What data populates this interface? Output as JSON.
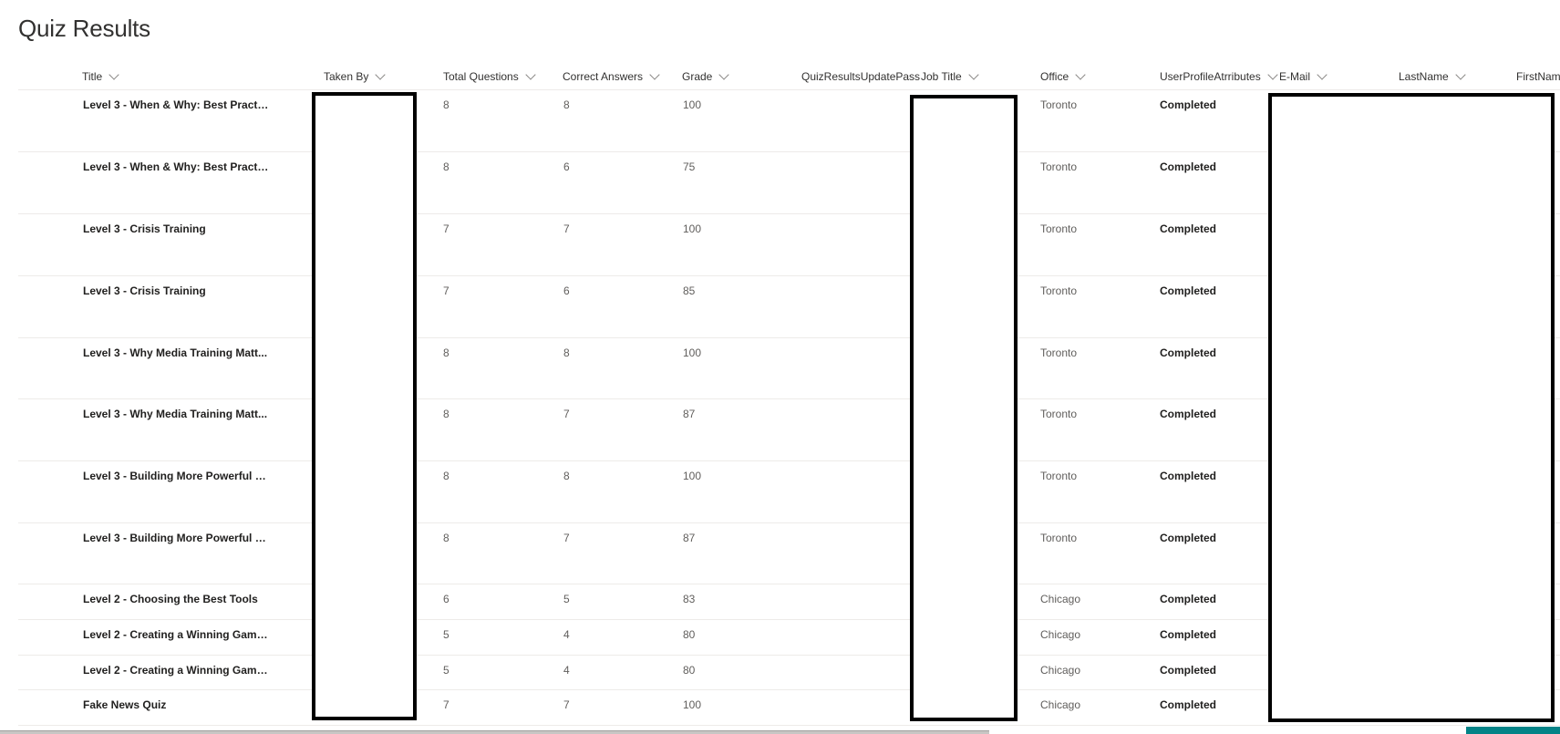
{
  "page": {
    "title": "Quiz Results"
  },
  "columns": [
    {
      "key": "title",
      "label": "Title",
      "sortable": true
    },
    {
      "key": "taken_by",
      "label": "Taken By",
      "sortable": true
    },
    {
      "key": "total_questions",
      "label": "Total Questions",
      "sortable": true
    },
    {
      "key": "correct_answers",
      "label": "Correct Answers",
      "sortable": true
    },
    {
      "key": "grade",
      "label": "Grade",
      "sortable": true
    },
    {
      "key": "update_pass",
      "label": "QuizResultsUpdatePassi",
      "sortable": false
    },
    {
      "key": "job_title",
      "label": "Job Title",
      "sortable": true
    },
    {
      "key": "office",
      "label": "Office",
      "sortable": true
    },
    {
      "key": "profile_attr",
      "label": "UserProfileAtrributes",
      "sortable": true
    },
    {
      "key": "email",
      "label": "E-Mail",
      "sortable": true
    },
    {
      "key": "last_name",
      "label": "LastName",
      "sortable": true
    },
    {
      "key": "first_name",
      "label": "FirstNam",
      "sortable": false
    }
  ],
  "rows": [
    {
      "title": "Level 3 - When & Why: Best Practic...",
      "total": "8",
      "correct": "8",
      "grade": "100",
      "office": "Toronto",
      "status": "Completed"
    },
    {
      "title": "Level 3 - When & Why: Best Practic...",
      "total": "8",
      "correct": "6",
      "grade": "75",
      "office": "Toronto",
      "status": "Completed"
    },
    {
      "title": "Level 3 - Crisis Training",
      "total": "7",
      "correct": "7",
      "grade": "100",
      "office": "Toronto",
      "status": "Completed"
    },
    {
      "title": "Level 3 - Crisis Training",
      "total": "7",
      "correct": "6",
      "grade": "85",
      "office": "Toronto",
      "status": "Completed"
    },
    {
      "title": "Level 3 - Why Media Training Matt...",
      "total": "8",
      "correct": "8",
      "grade": "100",
      "office": "Toronto",
      "status": "Completed"
    },
    {
      "title": "Level 3 - Why Media Training Matt...",
      "total": "8",
      "correct": "7",
      "grade": "87",
      "office": "Toronto",
      "status": "Completed"
    },
    {
      "title": "Level 3 - Building More Powerful P...",
      "total": "8",
      "correct": "8",
      "grade": "100",
      "office": "Toronto",
      "status": "Completed"
    },
    {
      "title": "Level 3 - Building More Powerful P...",
      "total": "8",
      "correct": "7",
      "grade": "87",
      "office": "Toronto",
      "status": "Completed"
    },
    {
      "title": "Level 2 - Choosing the Best Tools",
      "total": "6",
      "correct": "5",
      "grade": "83",
      "office": "Chicago",
      "status": "Completed"
    },
    {
      "title": "Level 2 - Creating a Winning Game...",
      "total": "5",
      "correct": "4",
      "grade": "80",
      "office": "Chicago",
      "status": "Completed"
    },
    {
      "title": "Level 2 - Creating a Winning Game...",
      "total": "5",
      "correct": "4",
      "grade": "80",
      "office": "Chicago",
      "status": "Completed"
    },
    {
      "title": "Fake News Quiz",
      "total": "7",
      "correct": "7",
      "grade": "100",
      "office": "Chicago",
      "status": "Completed"
    }
  ],
  "icons": {
    "sort": "chevron-down-icon"
  },
  "colors": {
    "accent": "#038387",
    "redaction": "#000000"
  }
}
